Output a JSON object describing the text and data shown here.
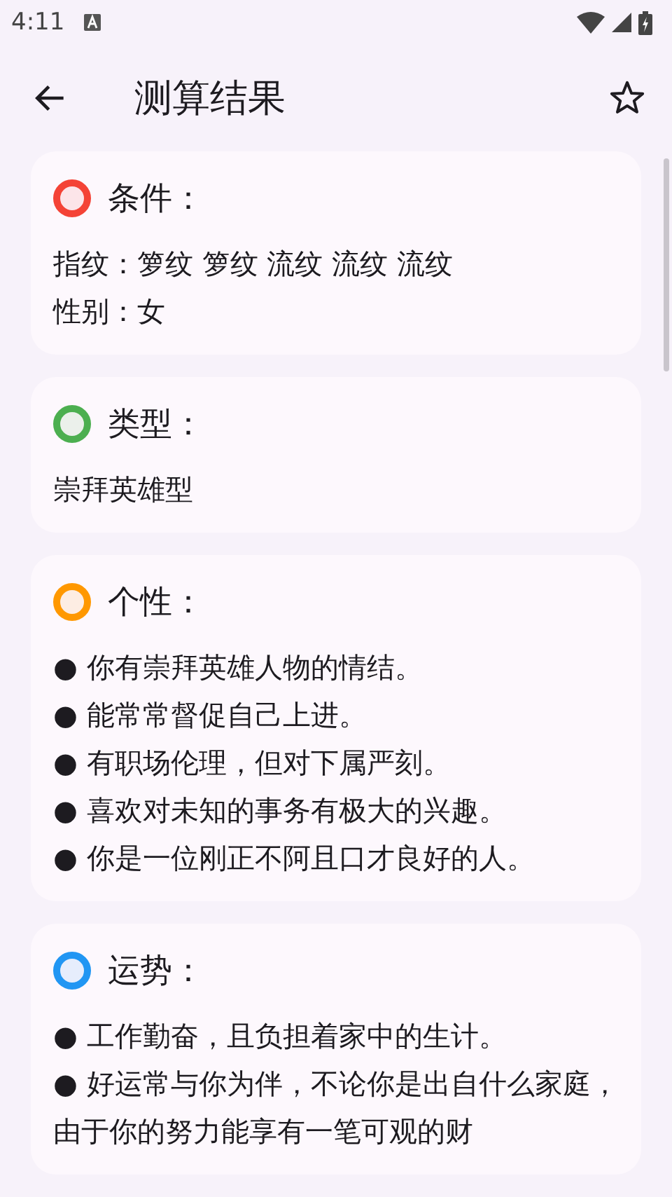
{
  "status_bar": {
    "time": "4:11"
  },
  "toolbar": {
    "title": "测算结果"
  },
  "cards": [
    {
      "title": "条件：",
      "color": "#f44336",
      "lines": [
        "指纹：箩纹 箩纹 流纹 流纹 流纹",
        "性别：女"
      ]
    },
    {
      "title": "类型：",
      "color": "#4caf50",
      "lines": [
        "崇拜英雄型"
      ]
    },
    {
      "title": "个性：",
      "color": "#ff9800",
      "lines": [
        "● 你有崇拜英雄人物的情结。",
        "● 能常常督促自己上进。",
        "● 有职场伦理，但对下属严刻。",
        "● 喜欢对未知的事务有极大的兴趣。",
        "● 你是一位刚正不阿且口才良好的人。"
      ]
    },
    {
      "title": "运势：",
      "color": "#2196f3",
      "lines": [
        "● 工作勤奋，且负担着家中的生计。",
        "● 好运常与你为伴，不论你是出自什么家庭，由于你的努力能享有一笔可观的财"
      ]
    }
  ]
}
